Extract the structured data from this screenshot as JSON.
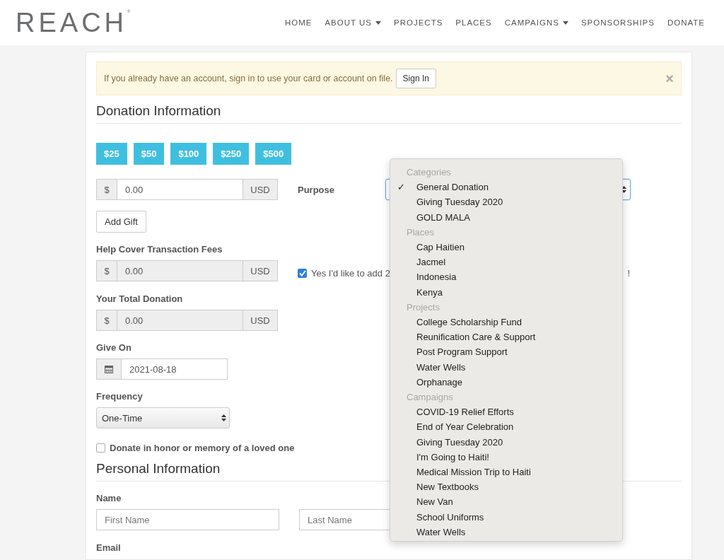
{
  "header": {
    "logo": "REACH$^{®}$",
    "nav": [
      {
        "label": "HOME",
        "has_menu": false
      },
      {
        "label": "ABOUT US",
        "has_menu": true
      },
      {
        "label": "PROJECTS",
        "has_menu": false
      },
      {
        "label": "PLACES",
        "has_menu": false
      },
      {
        "label": "CAMPAIGNS",
        "has_menu": true
      },
      {
        "label": "SPONSORSHIPS",
        "has_menu": false
      },
      {
        "label": "DONATE",
        "has_menu": false
      }
    ]
  },
  "alert": {
    "message": "If you already have an account, sign in to use your card or account on file.",
    "button": "Sign In",
    "close": "×"
  },
  "donation": {
    "title": "Donation Information",
    "presets": [
      "$25",
      "$50",
      "$100",
      "$250",
      "$500"
    ],
    "amount": {
      "prefix": "$",
      "value": "0.00",
      "suffix": "USD",
      "disabled": false
    },
    "purpose_label": "Purpose",
    "add_gift": "Add Gift",
    "fees": {
      "label": "Help Cover Transaction Fees",
      "prefix": "$",
      "value": "0.00",
      "suffix": "USD",
      "disabled": true
    },
    "cover_fees": {
      "checked": true,
      "text": "Yes I'd like to add 2",
      "text_end": "!"
    },
    "total": {
      "label": "Your Total Donation",
      "prefix": "$",
      "value": "0.00",
      "suffix": "USD",
      "disabled": true
    },
    "give_on": {
      "label": "Give On",
      "value": "2021-08-18"
    },
    "frequency": {
      "label": "Frequency",
      "value": "One-Time"
    },
    "honor": {
      "checked": false,
      "text": "Donate in honor or memory of a loved one"
    }
  },
  "personal": {
    "title": "Personal Information",
    "name_label": "Name",
    "first_placeholder": "First Name",
    "last_placeholder": "Last Name",
    "email_label": "Email"
  },
  "purpose_menu": {
    "check": "✓",
    "groups": [
      {
        "label": "Categories",
        "items": [
          {
            "label": "General Donation",
            "selected": true
          },
          {
            "label": "Giving Tuesday 2020",
            "selected": false
          },
          {
            "label": "GOLD MALA",
            "selected": false
          }
        ]
      },
      {
        "label": "Places",
        "items": [
          {
            "label": "Cap Haitien",
            "selected": false
          },
          {
            "label": "Jacmel",
            "selected": false
          },
          {
            "label": "Indonesia",
            "selected": false
          },
          {
            "label": "Kenya",
            "selected": false
          }
        ]
      },
      {
        "label": "Projects",
        "items": [
          {
            "label": "College Scholarship Fund",
            "selected": false
          },
          {
            "label": "Reunification Care & Support",
            "selected": false
          },
          {
            "label": "Post Program Support",
            "selected": false
          },
          {
            "label": "Water Wells",
            "selected": false
          },
          {
            "label": "Orphanage",
            "selected": false
          }
        ]
      },
      {
        "label": "Campaigns",
        "items": [
          {
            "label": "COVID-19 Relief Efforts",
            "selected": false
          },
          {
            "label": "End of Year Celebration",
            "selected": false
          },
          {
            "label": "Giving Tuesday 2020",
            "selected": false
          },
          {
            "label": "I'm Going to Haiti!",
            "selected": false
          },
          {
            "label": "Medical Mission Trip to Haiti",
            "selected": false
          },
          {
            "label": "New Textbooks",
            "selected": false
          },
          {
            "label": "New Van",
            "selected": false
          },
          {
            "label": "School Uniforms",
            "selected": false
          },
          {
            "label": "Water Wells",
            "selected": false
          }
        ]
      }
    ]
  }
}
